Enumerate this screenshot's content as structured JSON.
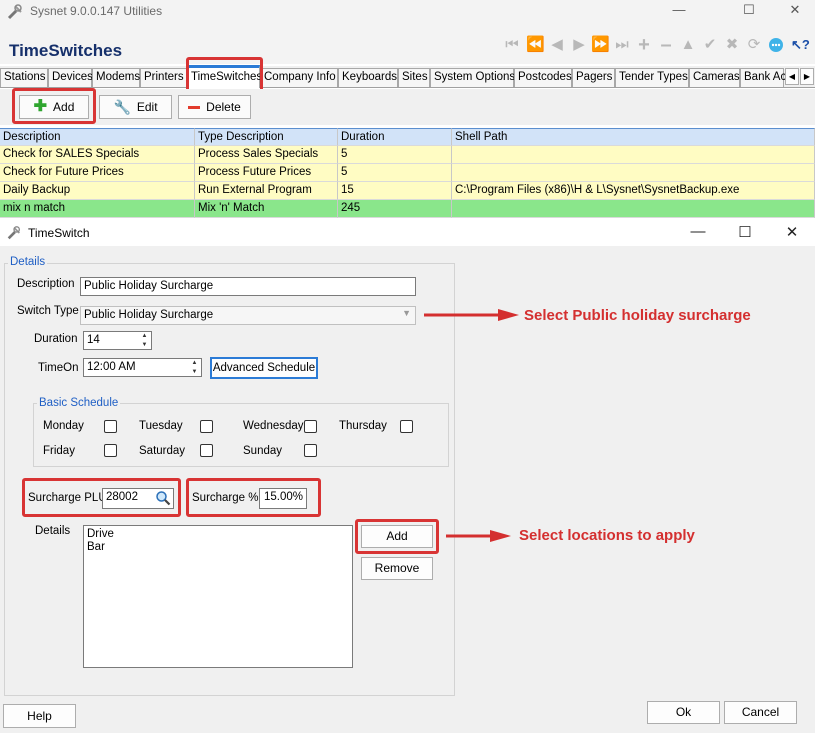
{
  "window": {
    "title": "Sysnet 9.0.0.147 Utilities",
    "page_title": "TimeSwitches",
    "minimize_icon": "minimize-icon",
    "maximize_icon": "maximize-icon",
    "close_icon": "close-icon",
    "nav_icons": [
      "first-icon",
      "prev-page-icon",
      "prev-icon",
      "next-icon",
      "next-page-icon",
      "last-icon",
      "add-icon",
      "remove-icon",
      "up-icon",
      "check-icon",
      "cancel-icon",
      "refresh-icon",
      "chat-icon",
      "help-pointer-icon"
    ]
  },
  "tabs": [
    "Stations",
    "Devices",
    "Modems",
    "Printers",
    "TimeSwitches",
    "Company Info",
    "Keyboards",
    "Sites",
    "System Options",
    "Postcodes",
    "Pagers",
    "Tender Types",
    "Cameras",
    "Bank Ac"
  ],
  "active_tab": "TimeSwitches",
  "toolbar": {
    "add_label": "Add",
    "edit_label": "Edit",
    "delete_label": "Delete"
  },
  "grid": {
    "columns": [
      "Description",
      "Type Description",
      "Duration",
      "Shell Path"
    ],
    "rows": [
      {
        "description": "Check for SALES Specials",
        "type": "Process Sales Specials",
        "duration": "5",
        "shell_path": ""
      },
      {
        "description": "Check for Future Prices",
        "type": "Process Future Prices",
        "duration": "5",
        "shell_path": ""
      },
      {
        "description": "Daily Backup",
        "type": "Run External Program",
        "duration": "15",
        "shell_path": "C:\\Program Files (x86)\\H & L\\Sysnet\\SysnetBackup.exe"
      },
      {
        "description": "mix n match",
        "type": "Mix 'n' Match",
        "duration": "245",
        "shell_path": ""
      }
    ]
  },
  "dialog": {
    "title": "TimeSwitch",
    "details_group": "Details",
    "description_label": "Description",
    "description_value": "Public Holiday Surcharge",
    "switch_type_label": "Switch Type",
    "switch_type_value": "Public Holiday Surcharge",
    "duration_label": "Duration",
    "duration_value": "14",
    "timeon_label": "TimeOn",
    "timeon_value": "12:00 AM",
    "advanced_schedule_label": "Advanced Schedule",
    "basic_schedule_group": "Basic Schedule",
    "days": [
      "Monday",
      "Tuesday",
      "Wednesday",
      "Thursday",
      "Friday",
      "Saturday",
      "Sunday"
    ],
    "surcharge_plu_label": "Surcharge PLU",
    "surcharge_plu_value": "28002",
    "surcharge_pct_label": "Surcharge %",
    "surcharge_pct_value": "15.00%",
    "details_list_label": "Details",
    "details_list": [
      "Drive",
      "Bar"
    ],
    "add_label": "Add",
    "remove_label": "Remove",
    "help_label": "Help",
    "ok_label": "Ok",
    "cancel_label": "Cancel"
  },
  "annotations": {
    "switch_type_note": "Select Public holiday surcharge",
    "locations_note": "Select locations to apply"
  },
  "colors": {
    "accent": "#2b7bd6",
    "highlight": "#d83434",
    "row_yellow": "#fffcc3",
    "row_green": "#8ae68b",
    "header_blue": "#d2e3f8",
    "legend_blue": "#1f5fc5",
    "title_navy": "#16306b"
  }
}
